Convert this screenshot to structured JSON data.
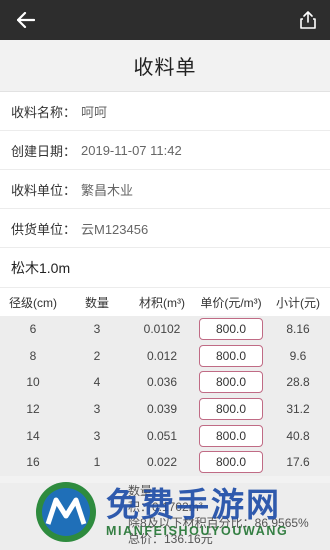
{
  "header": {
    "back_icon": "back-arrow-icon",
    "share_icon": "share-icon"
  },
  "page": {
    "title": "收料单"
  },
  "info": [
    {
      "label": "收料名称：",
      "value": "呵呵"
    },
    {
      "label": "创建日期：",
      "value": "2019-11-07 11:42"
    },
    {
      "label": "收料单位：",
      "value": "繁昌木业"
    },
    {
      "label": "供货单位：",
      "value": "云M123456"
    }
  ],
  "section": {
    "title": "松木1.0m"
  },
  "table": {
    "headers": [
      "径级(cm)",
      "数量",
      "材积(m³)",
      "单价(元/m³)",
      "小计(元)"
    ],
    "rows": [
      {
        "grade": "6",
        "qty": "3",
        "volume": "0.0102",
        "price": "800.0",
        "subtotal": "8.16"
      },
      {
        "grade": "8",
        "qty": "2",
        "volume": "0.012",
        "price": "800.0",
        "subtotal": "9.6"
      },
      {
        "grade": "10",
        "qty": "4",
        "volume": "0.036",
        "price": "800.0",
        "subtotal": "28.8"
      },
      {
        "grade": "12",
        "qty": "3",
        "volume": "0.039",
        "price": "800.0",
        "subtotal": "31.2"
      },
      {
        "grade": "14",
        "qty": "3",
        "volume": "0.051",
        "price": "800.0",
        "subtotal": "40.8"
      },
      {
        "grade": "16",
        "qty": "1",
        "volume": "0.022",
        "price": "800.0",
        "subtotal": "17.6"
      }
    ]
  },
  "summary": {
    "line1": "数量：",
    "line2": "积：0.1702m³",
    "line3": "除8及以下材积百分比：86.9565%",
    "line4": "总价：136.16元"
  },
  "watermark": {
    "title": "免费手游网",
    "subtitle": "MIANFEISHOUYOUWANG"
  },
  "colors": {
    "topbar": "#2d2d2d",
    "price_border": "#c06b85",
    "watermark_blue": "#1f4ea8",
    "watermark_green": "#2b7a3a"
  }
}
